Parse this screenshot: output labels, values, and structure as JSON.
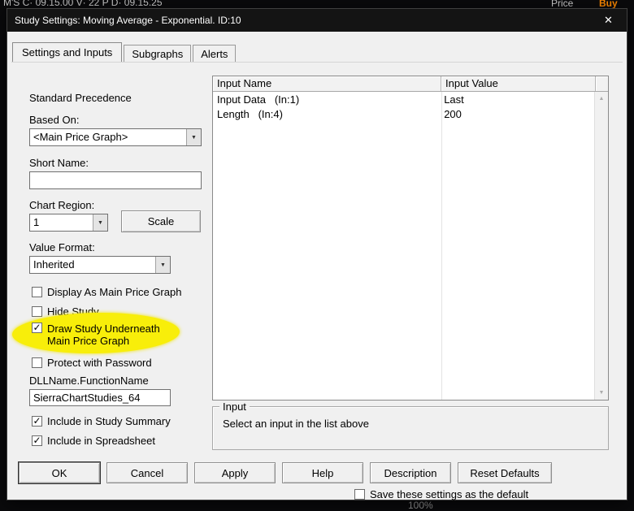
{
  "icons": {
    "close": "✕",
    "dropdown": "▼",
    "scroll_up": "▲",
    "scroll_down": "▼"
  },
  "background": {
    "top_left": "M'S C· 09.15.00 V· 22 P D· 09.15.25",
    "price_label": "Price",
    "buy_label": "Buy",
    "zoom_label": "100%"
  },
  "dialog": {
    "title": "Study Settings: Moving Average - Exponential. ID:10",
    "tabs": [
      {
        "label": "Settings and Inputs"
      },
      {
        "label": "Subgraphs"
      },
      {
        "label": "Alerts"
      }
    ],
    "left": {
      "standard_precedence": "Standard Precedence",
      "based_on_label": "Based On:",
      "based_on_value": "<Main Price Graph>",
      "short_name_label": "Short Name:",
      "short_name_value": "",
      "chart_region_label": "Chart Region:",
      "chart_region_value": "1",
      "scale_button": "Scale",
      "value_format_label": "Value Format:",
      "value_format_value": "Inherited",
      "checkboxes": [
        {
          "label": "Display As Main Price Graph",
          "mark": ""
        },
        {
          "label": "Hide Study",
          "mark": ""
        },
        {
          "label": "Draw Study Underneath Main Price Graph",
          "mark": "✓"
        },
        {
          "label": "Protect with Password",
          "mark": ""
        }
      ],
      "dll_label": "DLLName.FunctionName",
      "dll_value": "SierraChartStudies_64",
      "summary_checkboxes": [
        {
          "label": "Include in Study Summary",
          "mark": "✓"
        },
        {
          "label": "Include in Spreadsheet",
          "mark": "✓"
        }
      ]
    },
    "table": {
      "columns": [
        "Input Name",
        "Input Value"
      ],
      "rows": [
        {
          "name": "Input Data   (In:1)",
          "value": "Last"
        },
        {
          "name": "Length   (In:4)",
          "value": "200"
        }
      ]
    },
    "input_group": {
      "title": "Input",
      "message": "Select an input in the list above"
    },
    "buttons": [
      {
        "label": "OK"
      },
      {
        "label": "Cancel"
      },
      {
        "label": "Apply"
      },
      {
        "label": "Help"
      },
      {
        "label": "Description"
      },
      {
        "label": "Reset Defaults"
      }
    ],
    "save_default": {
      "label": "Save these settings as the default",
      "mark": ""
    }
  }
}
